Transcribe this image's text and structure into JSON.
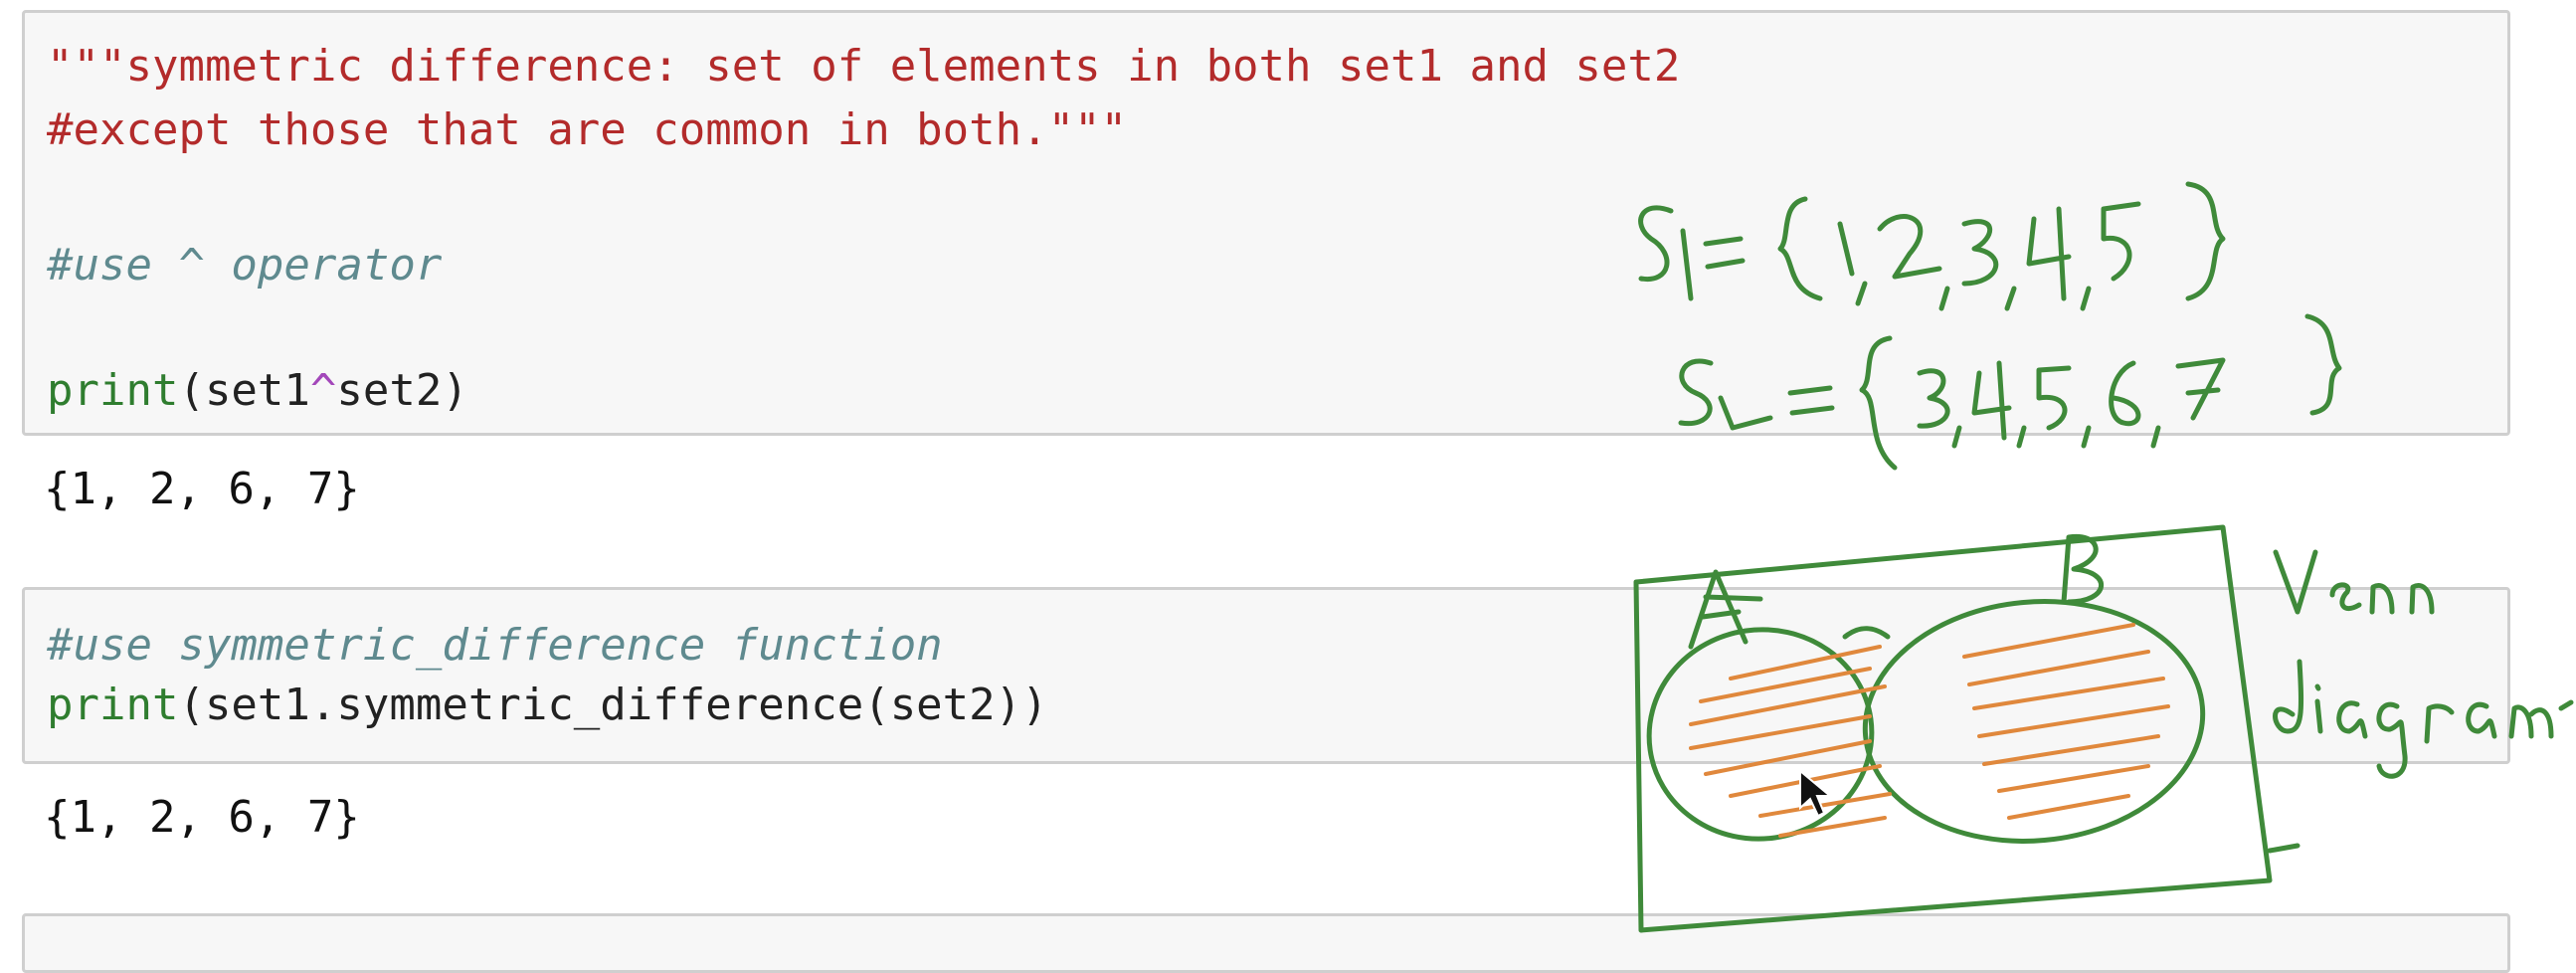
{
  "cells": [
    {
      "docstring_line1": "\"\"\"symmetric difference: set of elements in both set1 and set2",
      "docstring_line2": "#except those that are common in both.\"\"\"",
      "comment": "#use ^ operator",
      "print_kw": "print",
      "args_left": "(set1",
      "operator": "^",
      "args_right": "set2)",
      "output": "{1, 2, 6, 7}"
    },
    {
      "comment": "#use symmetric_difference function",
      "print_kw": "print",
      "args": "(set1.symmetric_difference(set2))",
      "output": "{1, 2, 6, 7}"
    }
  ],
  "annotation": {
    "ink_color": "#3f8a3a",
    "hatch_color": "#e0883c",
    "label_a": "A",
    "label_b": "B",
    "note_line1": "Venn",
    "note_line2": "diagram"
  }
}
